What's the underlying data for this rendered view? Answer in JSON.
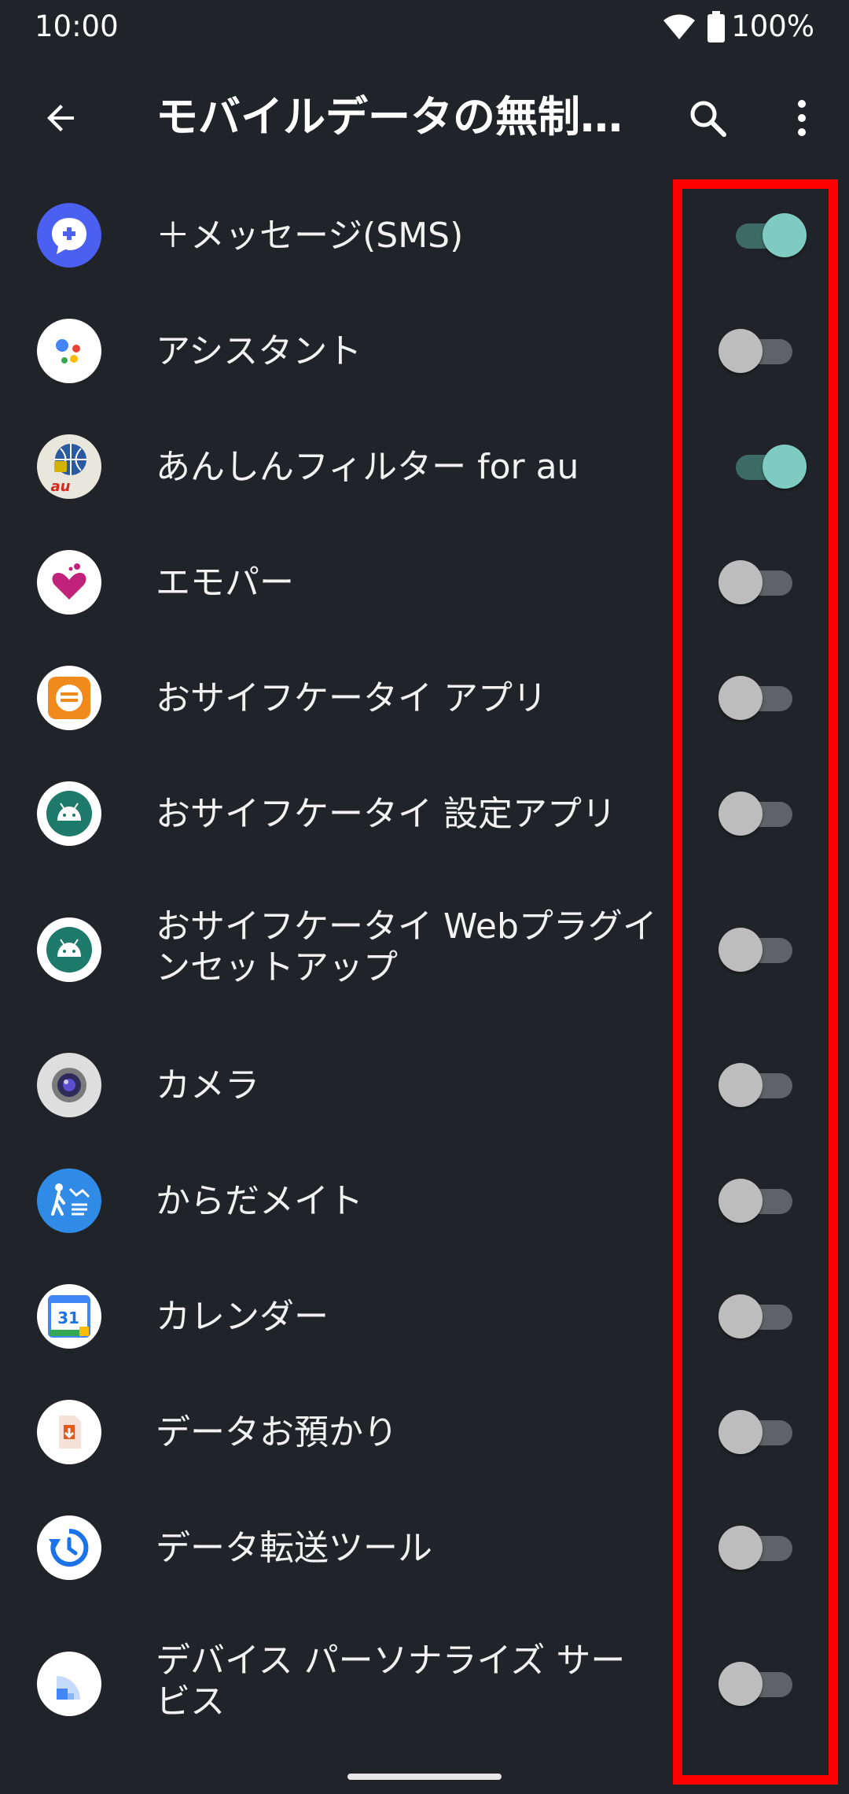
{
  "status_bar": {
    "time": "10:00",
    "battery": "100%"
  },
  "app_bar": {
    "title": "モバイルデータの無制…"
  },
  "apps": [
    {
      "label": "＋メッセージ(SMS)",
      "icon": "plus-message-icon",
      "enabled": true
    },
    {
      "label": "アシスタント",
      "icon": "google-assistant-icon",
      "enabled": false
    },
    {
      "label": "あんしんフィルター for au",
      "icon": "anshin-filter-icon",
      "enabled": true
    },
    {
      "label": "エモパー",
      "icon": "emopa-heart-icon",
      "enabled": false
    },
    {
      "label": "おサイフケータイ アプリ",
      "icon": "osaifu-keitai-icon",
      "enabled": false
    },
    {
      "label": "おサイフケータイ 設定アプリ",
      "icon": "android-icon",
      "enabled": false
    },
    {
      "label": "おサイフケータイ Webプラグインセットアップ",
      "icon": "android-icon",
      "enabled": false
    },
    {
      "label": "カメラ",
      "icon": "camera-icon",
      "enabled": false
    },
    {
      "label": "からだメイト",
      "icon": "karada-mate-icon",
      "enabled": false
    },
    {
      "label": "カレンダー",
      "icon": "calendar-icon",
      "enabled": false
    },
    {
      "label": "データお預かり",
      "icon": "data-azukari-icon",
      "enabled": false
    },
    {
      "label": "データ転送ツール",
      "icon": "data-transfer-icon",
      "enabled": false
    },
    {
      "label": "デバイス パーソナライズ サービス",
      "icon": "device-personalization-icon",
      "enabled": false
    }
  ],
  "calendar_icon_text": "31",
  "colors": {
    "background": "#202428",
    "toggle_on": "#7fcbc1",
    "highlight": "#ff0000"
  }
}
